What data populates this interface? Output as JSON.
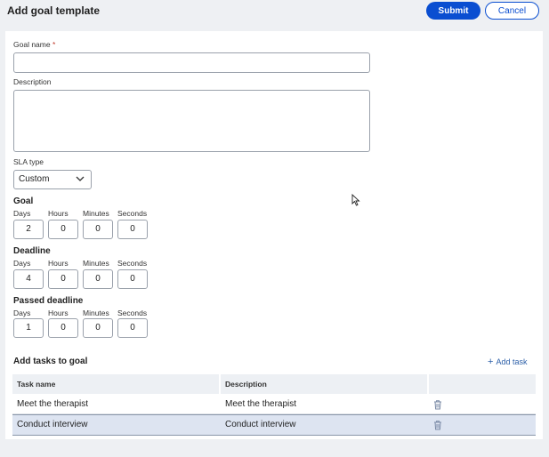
{
  "header": {
    "title": "Add goal template",
    "submit_label": "Submit",
    "cancel_label": "Cancel"
  },
  "form": {
    "goal_name_label": "Goal name",
    "required_marker": "*",
    "goal_name_value": "",
    "description_label": "Description",
    "description_value": "",
    "sla_type_label": "SLA type",
    "sla_type_value": "Custom"
  },
  "units": [
    "Days",
    "Hours",
    "Minutes",
    "Seconds"
  ],
  "goal": {
    "title": "Goal",
    "values": [
      "2",
      "0",
      "0",
      "0"
    ]
  },
  "deadline": {
    "title": "Deadline",
    "values": [
      "4",
      "0",
      "0",
      "0"
    ]
  },
  "passed_deadline": {
    "title": "Passed deadline",
    "values": [
      "1",
      "0",
      "0",
      "0"
    ]
  },
  "tasks": {
    "title": "Add tasks to goal",
    "add_label": "Add task",
    "columns": [
      "Task name",
      "Description"
    ],
    "rows": [
      {
        "name": "Meet the therapist",
        "description": "Meet the therapist"
      },
      {
        "name": "Conduct interview",
        "description": "Conduct interview"
      }
    ]
  },
  "colors": {
    "accent": "#0a4ed1",
    "selected_row": "#dde4f1",
    "required": "#c0392b"
  },
  "icons": [
    "chevron-down-icon",
    "plus-icon",
    "trash-icon",
    "mouse-cursor-icon"
  ]
}
